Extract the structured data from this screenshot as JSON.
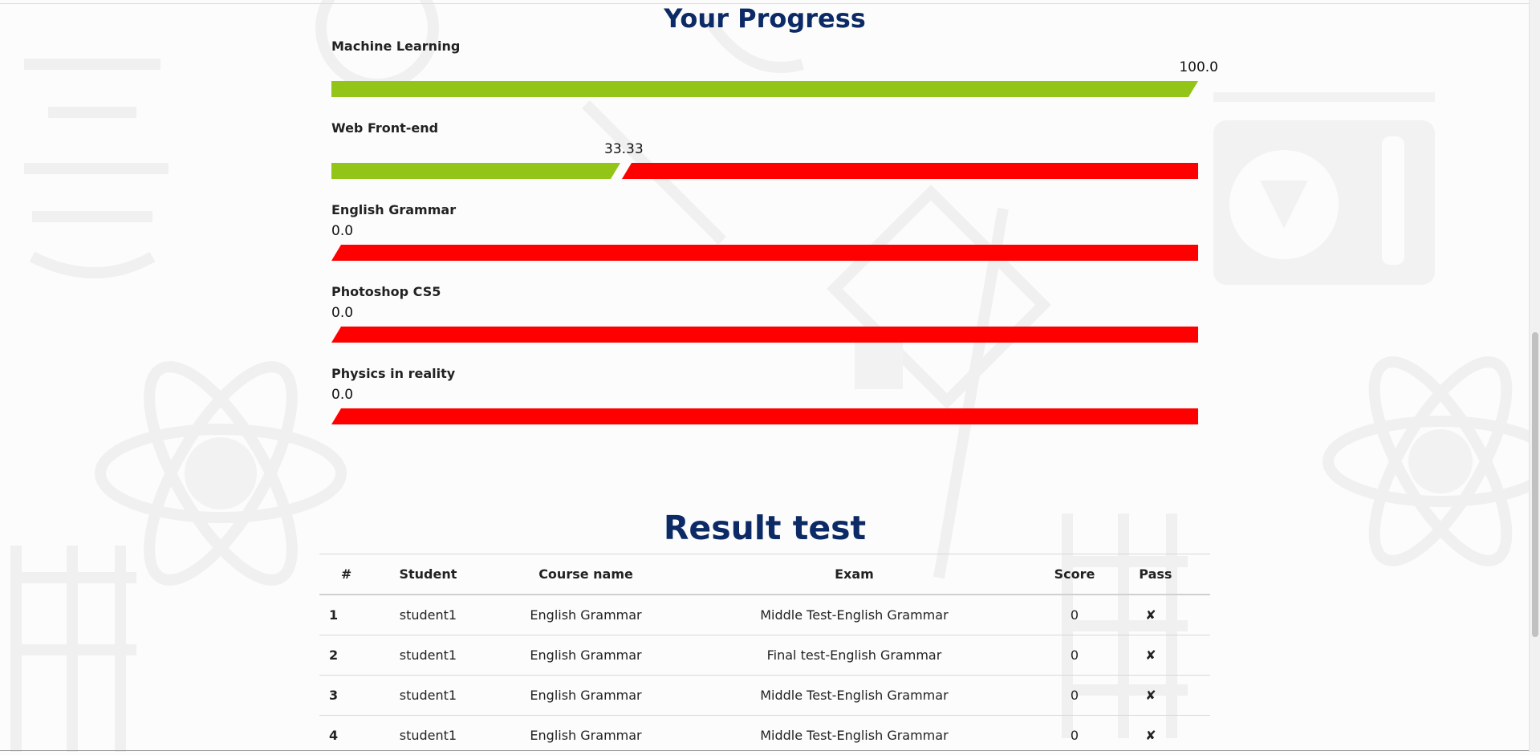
{
  "progress_section": {
    "title": "Your Progress",
    "courses": [
      {
        "name": "Machine Learning",
        "percent_label": "100.0",
        "percent": 100.0
      },
      {
        "name": "Web Front-end",
        "percent_label": "33.33",
        "percent": 33.33
      },
      {
        "name": "English Grammar",
        "percent_label": "0.0",
        "percent": 0.0
      },
      {
        "name": "Photoshop CS5",
        "percent_label": "0.0",
        "percent": 0.0
      },
      {
        "name": "Physics in reality",
        "percent_label": "0.0",
        "percent": 0.0
      }
    ],
    "colors": {
      "complete": "#93c418",
      "incomplete": "#ff0000",
      "title": "#0b2a66"
    }
  },
  "result_section": {
    "title": "Result test",
    "columns": [
      "#",
      "Student",
      "Course name",
      "Exam",
      "Score",
      "Pass"
    ],
    "rows": [
      {
        "num": "1",
        "student": "student1",
        "course": "English Grammar",
        "exam": "Middle Test-English Grammar",
        "score": "0",
        "pass": "✘"
      },
      {
        "num": "2",
        "student": "student1",
        "course": "English Grammar",
        "exam": "Final test-English Grammar",
        "score": "0",
        "pass": "✘"
      },
      {
        "num": "3",
        "student": "student1",
        "course": "English Grammar",
        "exam": "Middle Test-English Grammar",
        "score": "0",
        "pass": "✘"
      },
      {
        "num": "4",
        "student": "student1",
        "course": "English Grammar",
        "exam": "Middle Test-English Grammar",
        "score": "0",
        "pass": "✘"
      }
    ]
  }
}
